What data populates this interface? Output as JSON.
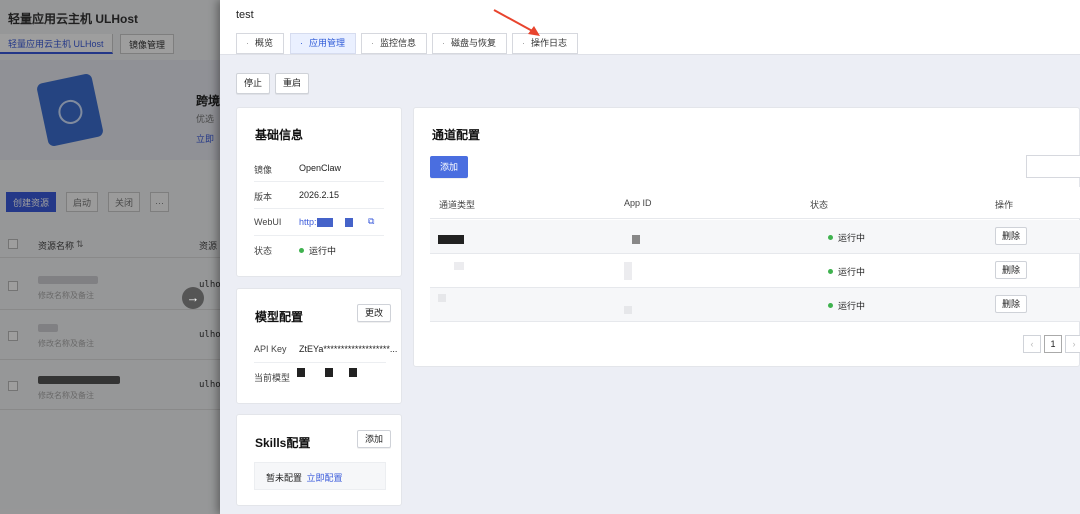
{
  "background": {
    "title": "轻量应用云主机 ULHost",
    "tabs": [
      "轻量应用云主机 ULHost",
      "镜像管理"
    ],
    "banner": {
      "heading": "跨境",
      "subtitle": "优选",
      "link": "立即"
    },
    "actions": [
      "创建资源",
      "启动",
      "关闭",
      "···"
    ],
    "columns": [
      "资源名称",
      "资源"
    ],
    "rows": [
      {
        "note": "修改名称及备注",
        "id": "ulho"
      },
      {
        "note": "修改名称及备注",
        "id": "ulho"
      },
      {
        "note": "修改名称及备注",
        "id": "ulho"
      }
    ],
    "arrow": "→"
  },
  "drawer": {
    "title": "test",
    "tabs": [
      "概览",
      "应用管理",
      "监控信息",
      "磁盘与恢复",
      "操作日志"
    ],
    "active_tab": "应用管理",
    "buttons": {
      "stop": "停止",
      "restart": "重启"
    },
    "basic": {
      "title": "基础信息",
      "image_label": "镜像",
      "image_value": "OpenClaw",
      "version_label": "版本",
      "version_value": "2026.2.15",
      "webui_label": "WebUI",
      "webui_value": "http:",
      "copy_icon": "⧉",
      "status_label": "状态",
      "status_value": "运行中"
    },
    "model": {
      "title": "模型配置",
      "edit": "更改",
      "apikey_label": "API Key",
      "apikey_value": "ZtEYa*******************...",
      "current_label": "当前模型"
    },
    "skills": {
      "title": "Skills配置",
      "add": "添加",
      "empty": "暂未配置",
      "link": "立即配置"
    },
    "channels": {
      "title": "通道配置",
      "add": "添加",
      "columns": [
        "通道类型",
        "App ID",
        "状态",
        "操作"
      ],
      "rows": [
        {
          "status": "运行中",
          "action": "删除"
        },
        {
          "status": "运行中",
          "action": "删除"
        },
        {
          "status": "运行中",
          "action": "删除"
        }
      ],
      "pagination": {
        "prev": "‹",
        "page": "1",
        "next": "›"
      }
    }
  },
  "colors": {
    "accent": "#4a6ee0",
    "status_green": "#3fb24f",
    "annotation": "#e8442e"
  }
}
